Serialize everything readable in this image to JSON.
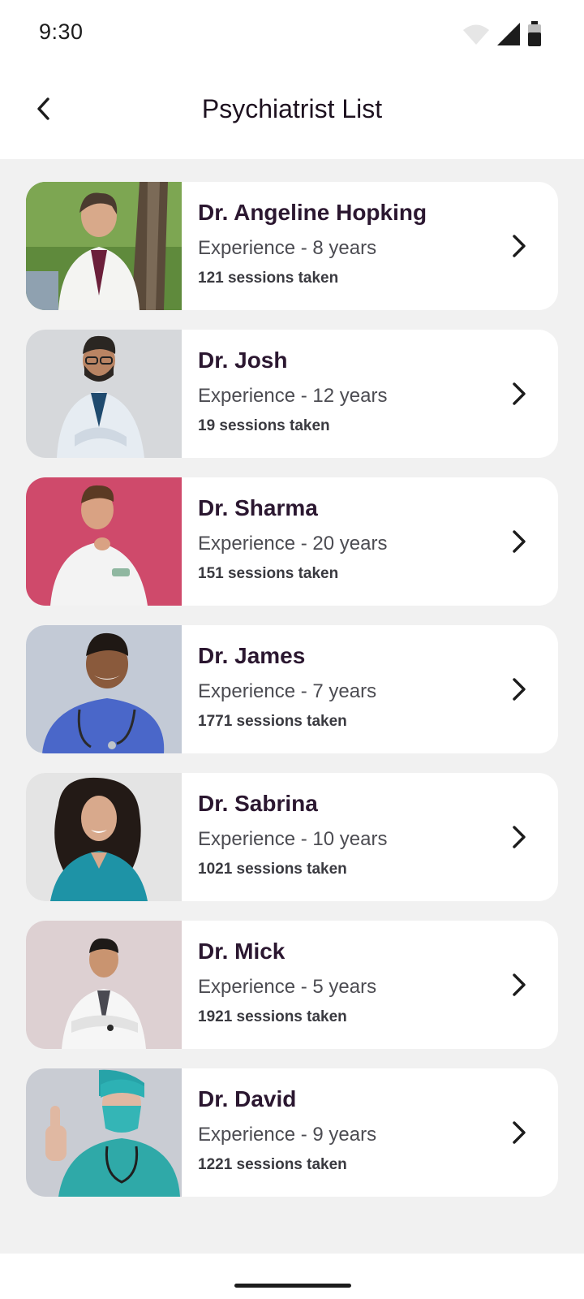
{
  "status": {
    "time": "9:30"
  },
  "header": {
    "title": "Psychiatrist List"
  },
  "doctors": [
    {
      "name": "Dr. Angeline Hopking",
      "experience": "Experience - 8 years",
      "sessions": "121 sessions taken"
    },
    {
      "name": "Dr. Josh",
      "experience": "Experience - 12 years",
      "sessions": "19 sessions taken"
    },
    {
      "name": "Dr. Sharma",
      "experience": "Experience - 20 years",
      "sessions": "151 sessions taken"
    },
    {
      "name": "Dr. James",
      "experience": "Experience - 7 years",
      "sessions": "1771 sessions taken"
    },
    {
      "name": "Dr. Sabrina",
      "experience": "Experience - 10 years",
      "sessions": "1021 sessions taken"
    },
    {
      "name": "Dr. Mick",
      "experience": "Experience - 5 years",
      "sessions": "1921 sessions taken"
    },
    {
      "name": "Dr. David",
      "experience": "Experience - 9 years",
      "sessions": "1221 sessions taken"
    }
  ],
  "colors": {
    "list_background": "#f1f1f1",
    "card_background": "#ffffff",
    "name_text": "#2b1730",
    "photo_backgrounds": [
      "#5f8a3c",
      "#d6d8db",
      "#cf4a6b",
      "#c3cad6",
      "#e4e4e4",
      "#ddd0d2",
      "#c9ccd3"
    ]
  },
  "icons": {
    "back": "chevron-left-icon",
    "row_action": "chevron-right-icon",
    "wifi": "wifi-icon",
    "signal": "cell-signal-icon",
    "battery": "battery-icon"
  }
}
